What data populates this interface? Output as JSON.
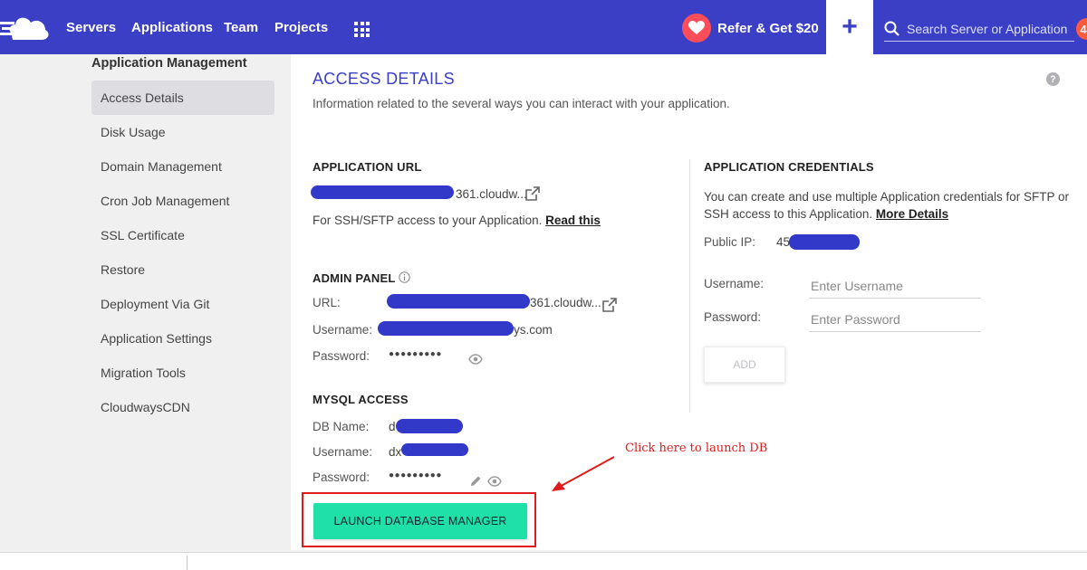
{
  "nav": {
    "logo_icon": "cloud-logo-icon",
    "items": [
      "Servers",
      "Applications",
      "Team",
      "Projects"
    ],
    "apps_icon": "apps-grid-icon",
    "refer_label": "Refer & Get $20",
    "refer_icon": "heart-icon",
    "plus_label": "+",
    "search_placeholder": "Search Server or Application",
    "notification_count": "4",
    "colors": {
      "bar": "#3a3fc6",
      "refer": "#ff4d5a",
      "badge": "#ff5a3d"
    }
  },
  "sidebar": {
    "title": "Application Management",
    "items": [
      {
        "label": "Access Details",
        "active": true
      },
      {
        "label": "Disk Usage"
      },
      {
        "label": "Domain Management"
      },
      {
        "label": "Cron Job Management"
      },
      {
        "label": "SSL Certificate"
      },
      {
        "label": "Restore"
      },
      {
        "label": "Deployment Via Git"
      },
      {
        "label": "Application Settings"
      },
      {
        "label": "Migration Tools"
      },
      {
        "label": "CloudwaysCDN"
      }
    ]
  },
  "main": {
    "title": "ACCESS DETAILS",
    "subtitle": "Information related to the several ways you can interact with your application.",
    "help_icon": "?",
    "app_url": {
      "heading": "APPLICATION URL",
      "value_suffix": "361.cloudw...",
      "ssh_text": "For SSH/SFTP access to your Application.",
      "read_this": "Read this"
    },
    "admin_panel": {
      "heading": "ADMIN PANEL",
      "url_label": "URL:",
      "url_suffix": "361.cloudw...",
      "username_label": "Username:",
      "username_suffix": "ys.com",
      "password_label": "Password:",
      "password_mask": "●●●●●●●●●"
    },
    "mysql": {
      "heading": "MYSQL ACCESS",
      "dbname_label": "DB Name:",
      "dbname_prefix": "d",
      "username_label": "Username:",
      "username_prefix": "dx",
      "password_label": "Password:",
      "password_mask": "●●●●●●●●●"
    },
    "credentials": {
      "heading": "APPLICATION CREDENTIALS",
      "desc": "You can create and use multiple Application credentials for SFTP or SSH access to this Application.",
      "more_details": "More Details",
      "public_ip_label": "Public IP:",
      "public_ip_prefix": "45",
      "username_label": "Username:",
      "username_placeholder": "Enter Username",
      "password_label": "Password:",
      "password_placeholder": "Enter Password",
      "add_label": "ADD"
    },
    "launch_label": "LAUNCH DATABASE MANAGER",
    "annotation": "Click here to launch DB",
    "colors": {
      "accent": "#3a3fc6",
      "launch": "#1fe0a6",
      "annotation": "#e01b1b",
      "redaction": "#3239c8"
    }
  }
}
